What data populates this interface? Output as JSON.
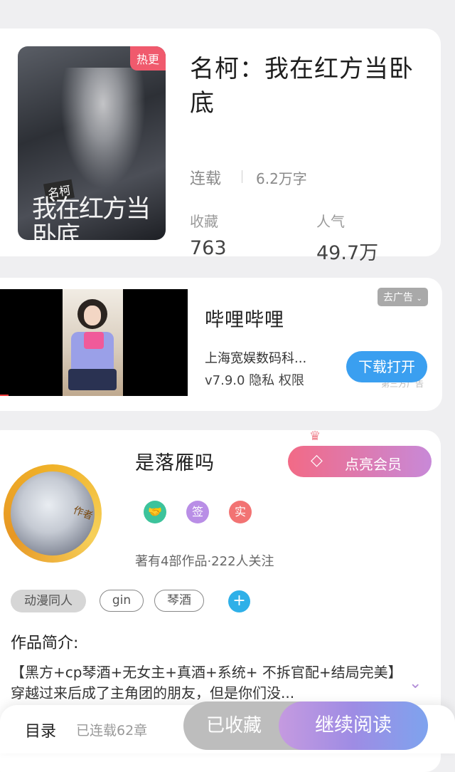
{
  "book": {
    "cover_tag": "热更",
    "cover_text_small": "名柯",
    "cover_text_main": "我在红方当卧底",
    "title": "名柯：我在红方当卧底",
    "status": "连载",
    "word_count": "6.2万字",
    "stats": [
      {
        "label": "收藏",
        "value": "763"
      },
      {
        "label": "人气",
        "value": "49.7万"
      }
    ]
  },
  "ad": {
    "badge": "去广告",
    "app_name": "哔哩哔哩",
    "company": "上海宽娱数码科...",
    "version_line": "v7.9.0  隐私  权限",
    "download_label": "下载打开",
    "under_text": "第三方广告"
  },
  "author": {
    "avatar_tag": "作者",
    "name": "是落雁吗",
    "vip_label": "点亮会员",
    "badges": [
      "签",
      "实"
    ],
    "meta": "著有4部作品·222人关注",
    "tags": [
      "动漫同人",
      "gin",
      "琴酒"
    ],
    "intro_title": "作品简介:",
    "intro_text": "【黑方+cp琴酒+无女主+真酒+系统+ 不拆官配+结局完美】穿越过来后成了主角团的朋友，但是你们没..."
  },
  "bottom_bar": {
    "toc_label": "目录",
    "toc_status": "已连载62章",
    "saved_label": "已收藏",
    "read_label": "继续阅读"
  },
  "colors": {
    "vip_gradient": [
      "#f26a86",
      "#c889d8"
    ],
    "read_gradient": [
      "#c59ae0",
      "#7ea3ee"
    ],
    "download_btn": "#3a9ff0",
    "hot_tag": "#f05a6d"
  }
}
